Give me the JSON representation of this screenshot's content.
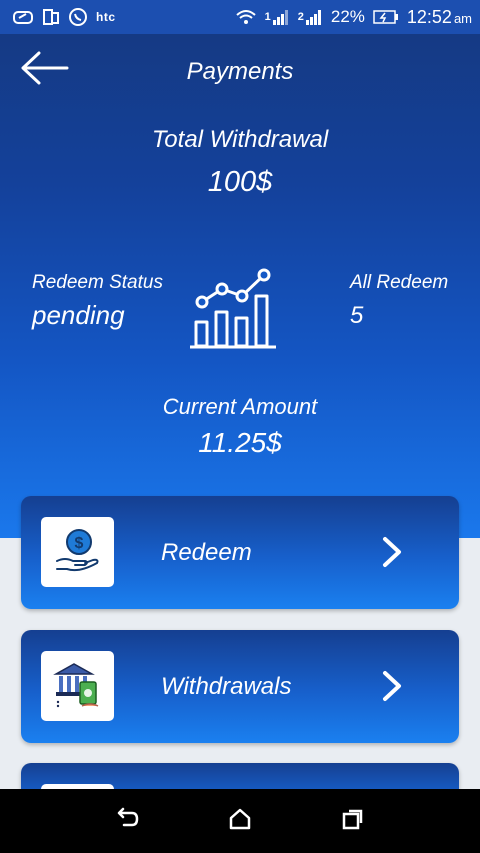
{
  "status_bar": {
    "carrier": "htc",
    "sim1": "1",
    "sim2": "2",
    "battery": "22%",
    "time": "12:52",
    "ampm": "am"
  },
  "header": {
    "title": "Payments"
  },
  "stats": {
    "total_withdrawal_label": "Total Withdrawal",
    "total_withdrawal_value": "100$",
    "redeem_status_label": "Redeem Status",
    "redeem_status_value": "pending",
    "all_redeem_label": "All Redeem",
    "all_redeem_value": "5",
    "current_amount_label": "Current Amount",
    "current_amount_value": "11.25$"
  },
  "menu": [
    {
      "label": "Redeem",
      "icon": "dollar-hand-icon"
    },
    {
      "label": "Withdrawals",
      "icon": "bank-withdrawal-icon"
    },
    {
      "label": "",
      "icon": ""
    }
  ],
  "colors": {
    "status_bar": "#1c4fb0",
    "hero_top": "#153a84",
    "hero_bottom": "#1a78ec",
    "card_top": "#153f91",
    "card_bottom": "#1a80f0",
    "page_bg": "#e9edf2"
  }
}
